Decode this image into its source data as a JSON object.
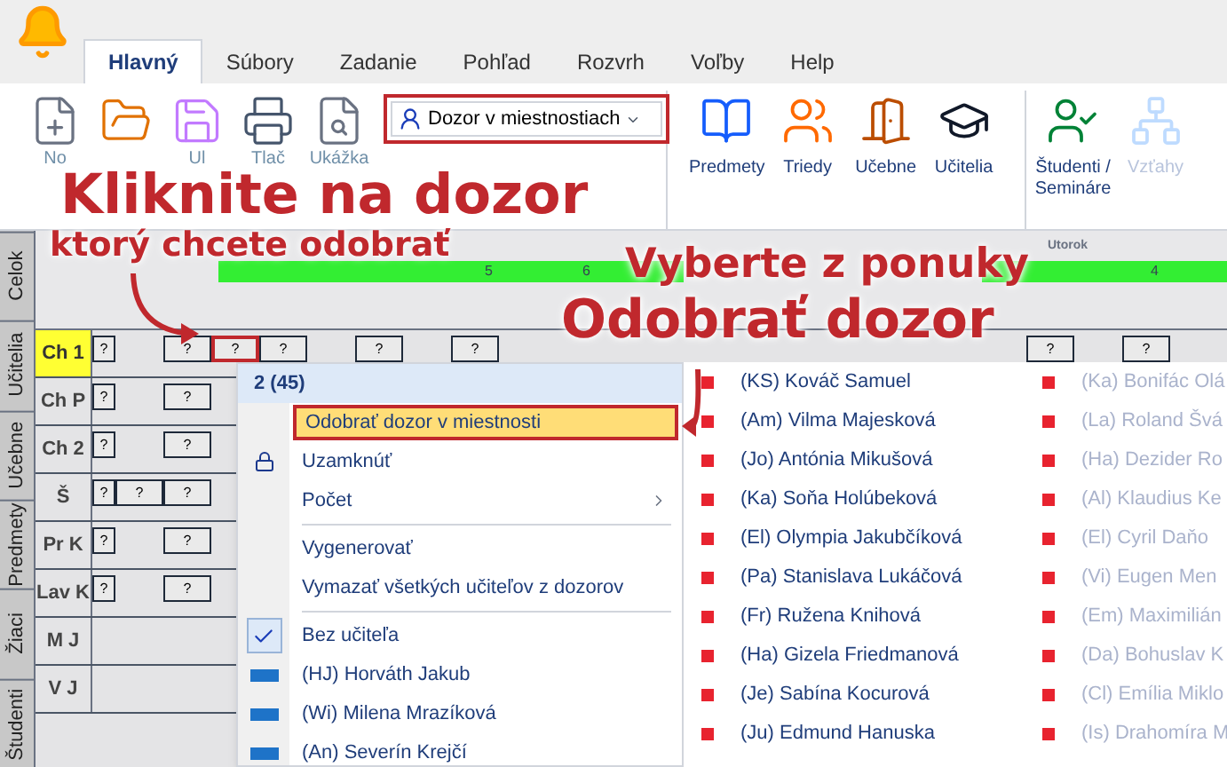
{
  "app_tabs": [
    {
      "label": "Hlavný",
      "selected": true
    },
    {
      "label": "Súbory",
      "selected": false
    },
    {
      "label": "Zadanie",
      "selected": false
    },
    {
      "label": "Pohľad",
      "selected": false
    },
    {
      "label": "Rozvrh",
      "selected": false
    },
    {
      "label": "Voľby",
      "selected": false
    },
    {
      "label": "Help",
      "selected": false
    }
  ],
  "file_buttons": [
    {
      "kind": "new",
      "label": "No"
    },
    {
      "kind": "open"
    },
    {
      "kind": "save",
      "label": "Ul"
    },
    {
      "kind": "print",
      "label": "Tlač"
    },
    {
      "kind": "preview",
      "label": "Ukážka"
    }
  ],
  "view_selector": {
    "label": "Dozor v miestnostiach"
  },
  "view_buttons": [
    {
      "kind": "subjects",
      "label": "Predmety",
      "disabled": false
    },
    {
      "kind": "classes",
      "label": "Triedy",
      "disabled": false
    },
    {
      "kind": "rooms",
      "label": "Učebne",
      "disabled": false
    },
    {
      "kind": "teachers",
      "label": "Učitelia",
      "disabled": false
    },
    {
      "kind": "students",
      "label": "Študenti / Semináre",
      "disabled": false
    },
    {
      "kind": "relations",
      "label": "Vzťahy",
      "disabled": true
    }
  ],
  "side_tabs": [
    "Celok",
    "Učitelia",
    "Učebne",
    "Predmety",
    "Žiaci",
    "Študenti"
  ],
  "timetable": {
    "day": "Utorok",
    "periods": [
      "5",
      "6",
      "4"
    ],
    "rows": [
      {
        "label": "Ch 1",
        "selected": true,
        "cells": [
          {
            "text": "?",
            "selected": false
          },
          {
            "text": ""
          },
          {
            "text": "?",
            "selected": false
          },
          {
            "text": "?",
            "selected": true
          },
          {
            "text": "?",
            "selected": false
          },
          {
            "text": ""
          },
          {
            "text": "?",
            "selected": false
          },
          {
            "text": ""
          },
          {
            "text": "?",
            "selected": false
          },
          {
            "text": ""
          },
          {
            "text": ""
          },
          {
            "text": ""
          },
          {
            "text": ""
          },
          {
            "text": ""
          },
          {
            "text": ""
          },
          {
            "text": ""
          },
          {
            "text": ""
          },
          {
            "text": ""
          },
          {
            "text": ""
          },
          {
            "text": ""
          },
          {
            "text": "?",
            "selected": false
          },
          {
            "text": ""
          },
          {
            "text": "?",
            "selected": false
          }
        ]
      },
      {
        "label": "Ch P",
        "selected": false,
        "cells": [
          {
            "text": "?",
            "selected": false
          },
          {
            "text": ""
          },
          {
            "text": "?",
            "selected": false
          }
        ]
      },
      {
        "label": "Ch 2",
        "selected": false,
        "cells": [
          {
            "text": "?",
            "selected": false
          },
          {
            "text": ""
          },
          {
            "text": "?",
            "selected": false
          }
        ]
      },
      {
        "label": "Š",
        "selected": false,
        "cells": [
          {
            "text": "?",
            "selected": false
          },
          {
            "text": "?",
            "selected": false
          },
          {
            "text": "?",
            "selected": false
          }
        ]
      },
      {
        "label": "Pr K",
        "selected": false,
        "cells": [
          {
            "text": "?",
            "selected": false
          },
          {
            "text": ""
          },
          {
            "text": "?",
            "selected": false
          }
        ]
      },
      {
        "label": "Lav K",
        "selected": false,
        "cells": [
          {
            "text": "?",
            "selected": false
          },
          {
            "text": ""
          },
          {
            "text": "?",
            "selected": false
          }
        ]
      },
      {
        "label": "M J",
        "selected": false,
        "cells": []
      },
      {
        "label": "V J",
        "selected": false,
        "cells": []
      }
    ]
  },
  "context_menu": {
    "header": "2 (45)",
    "items": [
      {
        "kind": "action",
        "label": "Odobrať dozor v miestnosti",
        "selected": true
      },
      {
        "kind": "lock",
        "label": "Uzamknúť",
        "selected": false
      },
      {
        "kind": "submenu",
        "label": "Počet",
        "selected": false
      },
      {
        "kind": "separator"
      },
      {
        "kind": "action",
        "label": "Vygenerovať",
        "selected": false
      },
      {
        "kind": "action",
        "label": "Vymazať všetkých učiteľov z dozorov",
        "selected": false
      },
      {
        "kind": "separator"
      },
      {
        "kind": "option",
        "label": "Bez učiteľa",
        "checked": true,
        "selected": false
      },
      {
        "kind": "teacher",
        "label": "(HJ) Horváth Jakub",
        "color": "#1e73c8",
        "selected": false
      },
      {
        "kind": "teacher",
        "label": "(Wi) Milena Mrazíková",
        "color": "#1e73c8",
        "selected": false
      },
      {
        "kind": "teacher",
        "label": "(An) Severín Krejčí",
        "color": "#1e73c8",
        "selected": false
      }
    ]
  },
  "teacher_columns": [
    [
      {
        "label": "(KS) Kováč Samuel",
        "color": "#e8232f"
      },
      {
        "label": "(Am) Vilma Majesková",
        "color": "#e8232f"
      },
      {
        "label": "(Jo) Antónia Mikušová",
        "color": "#e8232f"
      },
      {
        "label": "(Ka) Soňa Holúbeková",
        "color": "#e8232f"
      },
      {
        "label": "(El) Olympia Jakubčíková",
        "color": "#e8232f"
      },
      {
        "label": "(Pa) Stanislava Lukáčová",
        "color": "#e8232f"
      },
      {
        "label": "(Fr) Ružena Knihová",
        "color": "#e8232f"
      },
      {
        "label": "(Ha) Gizela Friedmanová",
        "color": "#e8232f"
      },
      {
        "label": "(Je) Sabína Kocurová",
        "color": "#e8232f"
      },
      {
        "label": "(Ju) Edmund Hanuska",
        "color": "#e8232f"
      }
    ],
    [
      {
        "label": "(Ka) Bonifác Olá",
        "color": "#e8232f"
      },
      {
        "label": "(La) Roland Švá",
        "color": "#e8232f"
      },
      {
        "label": "(Ha) Dezider Ro",
        "color": "#e8232f"
      },
      {
        "label": "(Al) Klaudius Ke",
        "color": "#e8232f"
      },
      {
        "label": "(El) Cyril Daňo",
        "color": "#e8232f"
      },
      {
        "label": "(Vi) Eugen Men",
        "color": "#e8232f"
      },
      {
        "label": "(Em) Maximilián",
        "color": "#e8232f"
      },
      {
        "label": "(Da) Bohuslav K",
        "color": "#e8232f"
      },
      {
        "label": "(Cl) Emília Miklo",
        "color": "#e8232f"
      },
      {
        "label": "(Is) Drahomíra M",
        "color": "#e8232f"
      }
    ]
  ],
  "annotations": [
    "Kliknite na dozor",
    "ktorý chcete odobrať",
    "Vyberte z ponuky",
    "Odobrať dozor"
  ]
}
